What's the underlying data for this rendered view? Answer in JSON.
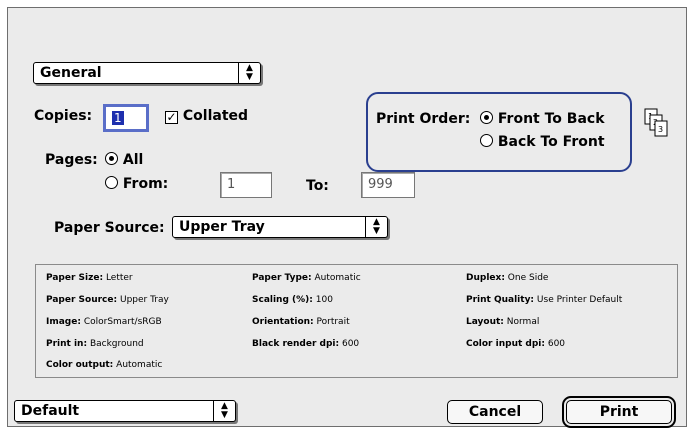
{
  "panel_menu": {
    "value": "General"
  },
  "copies": {
    "label": "Copies:",
    "value": "1"
  },
  "collated": {
    "label": "Collated",
    "checked": true
  },
  "pages": {
    "label": "Pages:",
    "all_label": "All",
    "from_label": "From:",
    "from_value": "1",
    "to_label": "To:",
    "to_value": "999"
  },
  "print_order": {
    "label": "Print Order:",
    "options": [
      "Front To Back",
      "Back To Front"
    ],
    "selected": "Front To Back"
  },
  "paper_source": {
    "label": "Paper Source:",
    "value": "Upper Tray"
  },
  "summary": {
    "col1": [
      {
        "key": "Paper Size:",
        "value": "Letter"
      },
      {
        "key": "Paper Source:",
        "value": "Upper Tray"
      },
      {
        "key": "Image:",
        "value": "ColorSmart/sRGB"
      },
      {
        "key": "Print in:",
        "value": "Background"
      },
      {
        "key": "Color output:",
        "value": "Automatic"
      }
    ],
    "col2": [
      {
        "key": "Paper Type:",
        "value": "Automatic"
      },
      {
        "key": "Scaling (%):",
        "value": "100"
      },
      {
        "key": "Orientation:",
        "value": "Portrait"
      },
      {
        "key": "Black render dpi:",
        "value": "600"
      }
    ],
    "col3": [
      {
        "key": "Duplex:",
        "value": "One Side"
      },
      {
        "key": "Print Quality:",
        "value": "Use Printer Default"
      },
      {
        "key": "Layout:",
        "value": "Normal"
      },
      {
        "key": "Color input dpi:",
        "value": "600"
      }
    ]
  },
  "preset_menu": {
    "value": "Default"
  },
  "buttons": {
    "cancel": "Cancel",
    "print": "Print"
  },
  "icons": {
    "page_order": "page-order-icon",
    "popup_arrows": "popup-arrows-icon"
  },
  "colors": {
    "highlight_box": "#2a3f8f",
    "dialog_bg": "#ebebeb",
    "copies_focus": "#5a6ec8"
  }
}
